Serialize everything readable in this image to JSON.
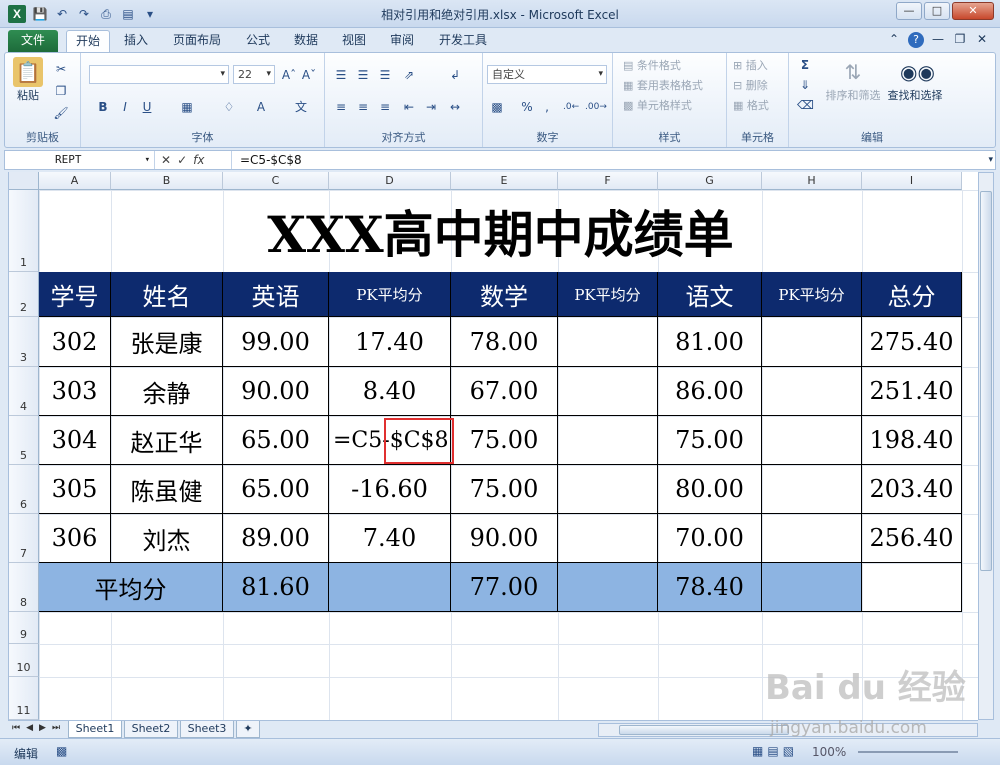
{
  "window": {
    "title": "相对引用和绝对引用.xlsx - Microsoft Excel",
    "app_icon": "X"
  },
  "ribbon_tabs": [
    "文件",
    "开始",
    "插入",
    "页面布局",
    "公式",
    "数据",
    "视图",
    "审阅",
    "开发工具"
  ],
  "ribbon": {
    "paste": "粘贴",
    "font_name": "",
    "font_size": "22",
    "number_format": "自定义",
    "conditional_format": "条件格式",
    "table_format": "套用表格格式",
    "cell_style": "单元格样式",
    "insert": "插入",
    "delete": "删除",
    "format": "格式",
    "sort_filter": "排序和筛选",
    "find_select": "查找和选择",
    "groups": {
      "clipboard": "剪贴板",
      "font": "字体",
      "alignment": "对齐方式",
      "number": "数字",
      "styles": "样式",
      "cells": "单元格",
      "editing": "编辑"
    },
    "bold": "B",
    "italic": "I",
    "underline": "U",
    "pct": "%",
    "comma": ","
  },
  "formula_bar": {
    "name_box": "REPT",
    "fx": "fx",
    "formula": "=C5-$C$8"
  },
  "columns": [
    "A",
    "B",
    "C",
    "D",
    "E",
    "F",
    "G",
    "H",
    "I"
  ],
  "rows": [
    "1",
    "2",
    "3",
    "4",
    "5",
    "6",
    "7",
    "8",
    "9",
    "10",
    "11"
  ],
  "sheet": {
    "title": "XXX高中期中成绩单",
    "headers": [
      "学号",
      "姓名",
      "英语",
      "PK平均分",
      "数学",
      "PK平均分",
      "语文",
      "PK平均分",
      "总分"
    ],
    "data_rows": [
      [
        "302",
        "张是康",
        "99.00",
        "17.40",
        "78.00",
        "",
        "81.00",
        "",
        "275.40"
      ],
      [
        "303",
        "余静",
        "90.00",
        "8.40",
        "67.00",
        "",
        "86.00",
        "",
        "251.40"
      ],
      [
        "304",
        "赵正华",
        "65.00",
        "=C5-$C$8",
        "75.00",
        "",
        "75.00",
        "",
        "198.40"
      ],
      [
        "305",
        "陈虽健",
        "65.00",
        "-16.60",
        "75.00",
        "",
        "80.00",
        "",
        "203.40"
      ],
      [
        "306",
        "刘杰",
        "89.00",
        "7.40",
        "90.00",
        "",
        "70.00",
        "",
        "256.40"
      ]
    ],
    "average_row": {
      "label": "平均分",
      "english": "81.60",
      "math": "77.00",
      "chinese": "78.40"
    },
    "formula_parts": {
      "relative": "=C5-",
      "absolute": "$C$8"
    }
  },
  "sheet_tabs": [
    "Sheet1",
    "Sheet2",
    "Sheet3"
  ],
  "status": {
    "mode": "编辑",
    "zoom": "100%"
  },
  "watermark": {
    "brand": "Bai du 经验",
    "url": "jingyan.baidu.com"
  },
  "colors": {
    "header_bg": "#0d2a6e",
    "average_bg": "#8db4e2",
    "highlight_box": "#e03030",
    "file_tab": "#1d6b3a"
  }
}
